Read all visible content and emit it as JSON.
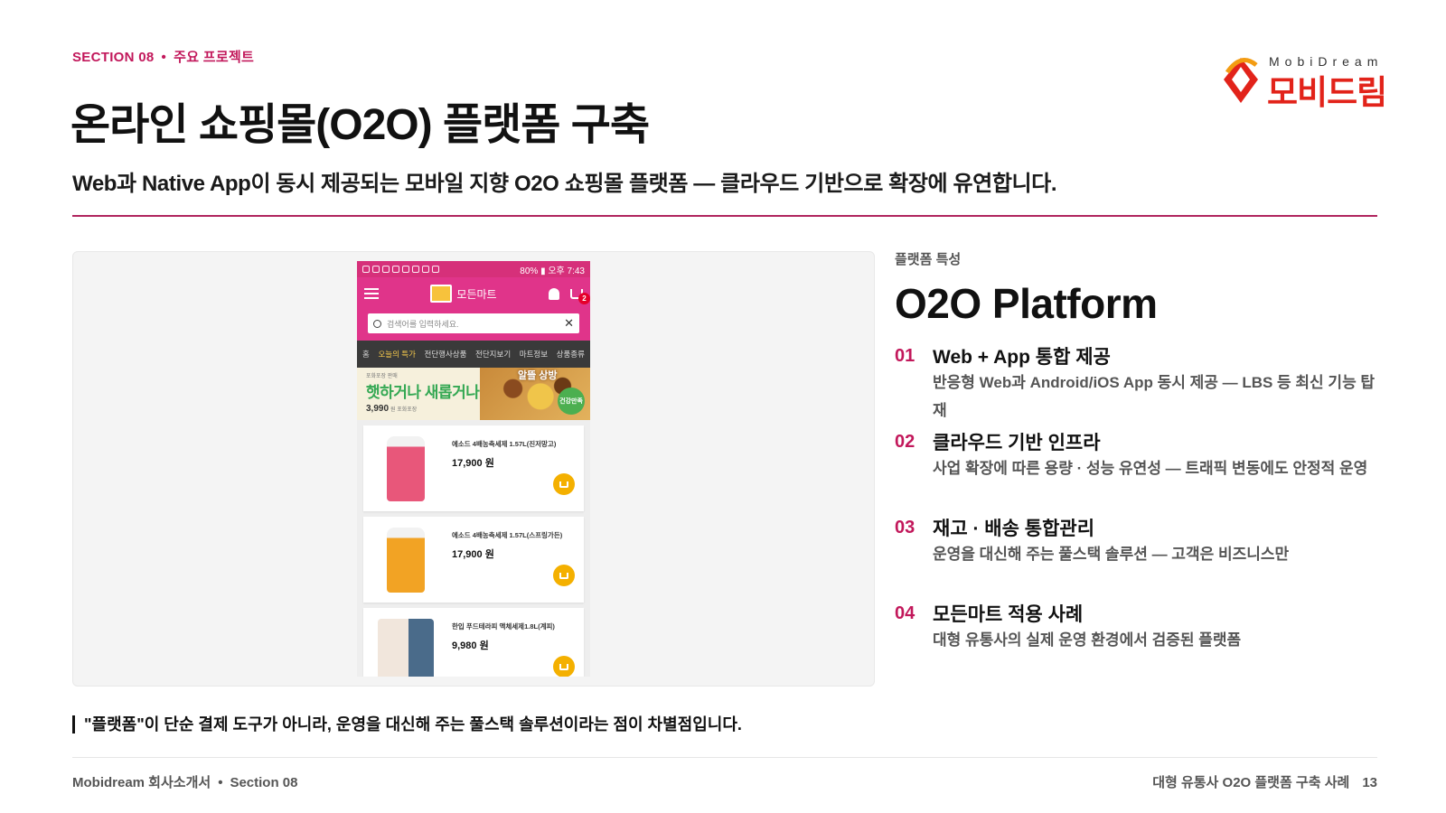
{
  "header": {
    "section_label": "SECTION 08",
    "section_topic": "주요 프로젝트",
    "title": "온라인 쇼핑몰(O2O) 플랫폼 구축",
    "subtitle": "Web과 Native App이 동시 제공되는 모바일 지향 O2O 쇼핑몰 플랫폼 — 클라우드 기반으로 확장에 유연합니다.",
    "accent_color": "#c2185b"
  },
  "logo": {
    "english": "MobiDream",
    "korean": "모비드림"
  },
  "screenshot": {
    "status_time": "80% ▮ 오후 7:43",
    "brand": "모든마트",
    "cart_count": "2",
    "search_placeholder": "검색어를 입력하세요.",
    "nav_tabs": [
      "홈",
      "오늘의 특가",
      "전단행사상품",
      "전단지보기",
      "마트정보",
      "상품종류"
    ],
    "banner": {
      "small_text": "포화포장 판매",
      "headline": "햇하거나 새롭거나",
      "tag": "알뜰 상방",
      "price": "3,990",
      "price_note": "원 포화포장",
      "badge": "건강만족"
    },
    "products": [
      {
        "name": "에소드 4배농축세제 1.57L(진저망고)",
        "price": "17,900 원"
      },
      {
        "name": "에소드 4배농축세제 1.57L(스프링가든)",
        "price": "17,900 원"
      },
      {
        "name": "한입 푸드테라피 액체세제1.8L(계피)",
        "price": "9,980 원"
      }
    ]
  },
  "platform": {
    "kicker": "플랫폼 특성",
    "title": "O2O Platform",
    "features": [
      {
        "num": "01",
        "title": "Web + App 통합 제공",
        "desc": "반응형 Web과 Android/iOS App 동시 제공 — LBS 등 최신 기능 탑재"
      },
      {
        "num": "02",
        "title": "클라우드 기반 인프라",
        "desc": "사업 확장에 따른 용량 · 성능 유연성 — 트래픽 변동에도 안정적 운영"
      },
      {
        "num": "03",
        "title": "재고 · 배송 통합관리",
        "desc": "운영을 대신해 주는 풀스택 솔루션 — 고객은 비즈니스만"
      },
      {
        "num": "04",
        "title": "모든마트 적용 사례",
        "desc": "대형 유통사의 실제 운영 환경에서 검증된 플랫폼"
      }
    ]
  },
  "quote": "\"플랫폼\"이 단순 결제 도구가 아니라, 운영을 대신해 주는 풀스택 솔루션이라는 점이 차별점입니다.",
  "footer": {
    "doc_name": "Mobidream 회사소개서",
    "section": "Section 08",
    "right_text": "대형 유통사 O2O 플랫폼 구축 사례",
    "page": "13"
  }
}
